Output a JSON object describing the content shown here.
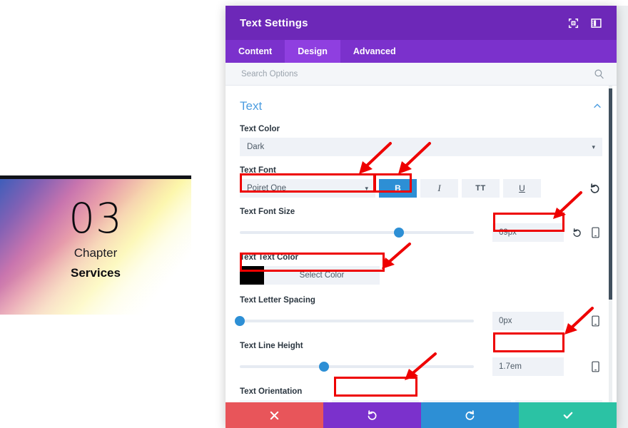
{
  "preview": {
    "number": "03",
    "chapter": "Chapter",
    "services": "Services"
  },
  "window": {
    "title": "Text Settings",
    "header_icons": [
      {
        "name": "fullscreen-icon"
      },
      {
        "name": "panel-layout-icon"
      }
    ],
    "tabs": [
      {
        "label": "Content",
        "active": false
      },
      {
        "label": "Design",
        "active": true
      },
      {
        "label": "Advanced",
        "active": false
      }
    ],
    "search": {
      "placeholder": "Search Options",
      "value": "",
      "icon": "search-icon"
    }
  },
  "section": {
    "title": "Text",
    "collapse_icon": "chevron-up-icon"
  },
  "fields": {
    "text_color": {
      "label": "Text Color",
      "value": "Dark",
      "caret": "▾"
    },
    "text_font": {
      "label": "Text Font",
      "value": "Poiret One",
      "caret": "▾",
      "styles": [
        {
          "name": "bold-button",
          "label": "B",
          "active": true
        },
        {
          "name": "italic-button",
          "label": "I",
          "active": false
        },
        {
          "name": "uppercase-button",
          "label": "TT",
          "active": false
        },
        {
          "name": "underline-button",
          "label": "U",
          "active": false
        }
      ],
      "reset_icon": "reset-icon"
    },
    "text_font_size": {
      "label": "Text Font Size",
      "value": "69px",
      "slider_percent": 68,
      "reset_icon": "reset-icon",
      "device_icon": "mobile-icon"
    },
    "text_text_color": {
      "label": "Text Text Color",
      "button_label": "Select Color",
      "swatch_hex": "#000000"
    },
    "text_letter_spacing": {
      "label": "Text Letter Spacing",
      "value": "0px",
      "slider_percent": 0,
      "device_icon": "mobile-icon"
    },
    "text_line_height": {
      "label": "Text Line Height",
      "value": "1.7em",
      "slider_percent": 36,
      "device_icon": "mobile-icon"
    },
    "text_orientation": {
      "label": "Text Orientation",
      "options": [
        {
          "name": "align-left-button",
          "active": false
        },
        {
          "name": "align-center-button",
          "active": true
        },
        {
          "name": "align-right-button",
          "active": false
        },
        {
          "name": "align-justify-button",
          "active": false
        }
      ]
    }
  },
  "footer": {
    "buttons": [
      {
        "name": "cancel-button",
        "icon": "close-icon",
        "color": "#e8555a"
      },
      {
        "name": "undo-button",
        "icon": "undo-icon",
        "color": "#7b31cc"
      },
      {
        "name": "redo-button",
        "icon": "redo-icon",
        "color": "#2d8fd5"
      },
      {
        "name": "save-button",
        "icon": "check-icon",
        "color": "#2bc2a4"
      }
    ]
  },
  "colors": {
    "header_purple": "#6d28b8",
    "tab_purple": "#7b31cc",
    "tab_active_purple": "#8f3fe0",
    "accent_blue": "#2d8fd5",
    "section_title_blue": "#4c9de0",
    "annotation_red": "#ee0000"
  }
}
